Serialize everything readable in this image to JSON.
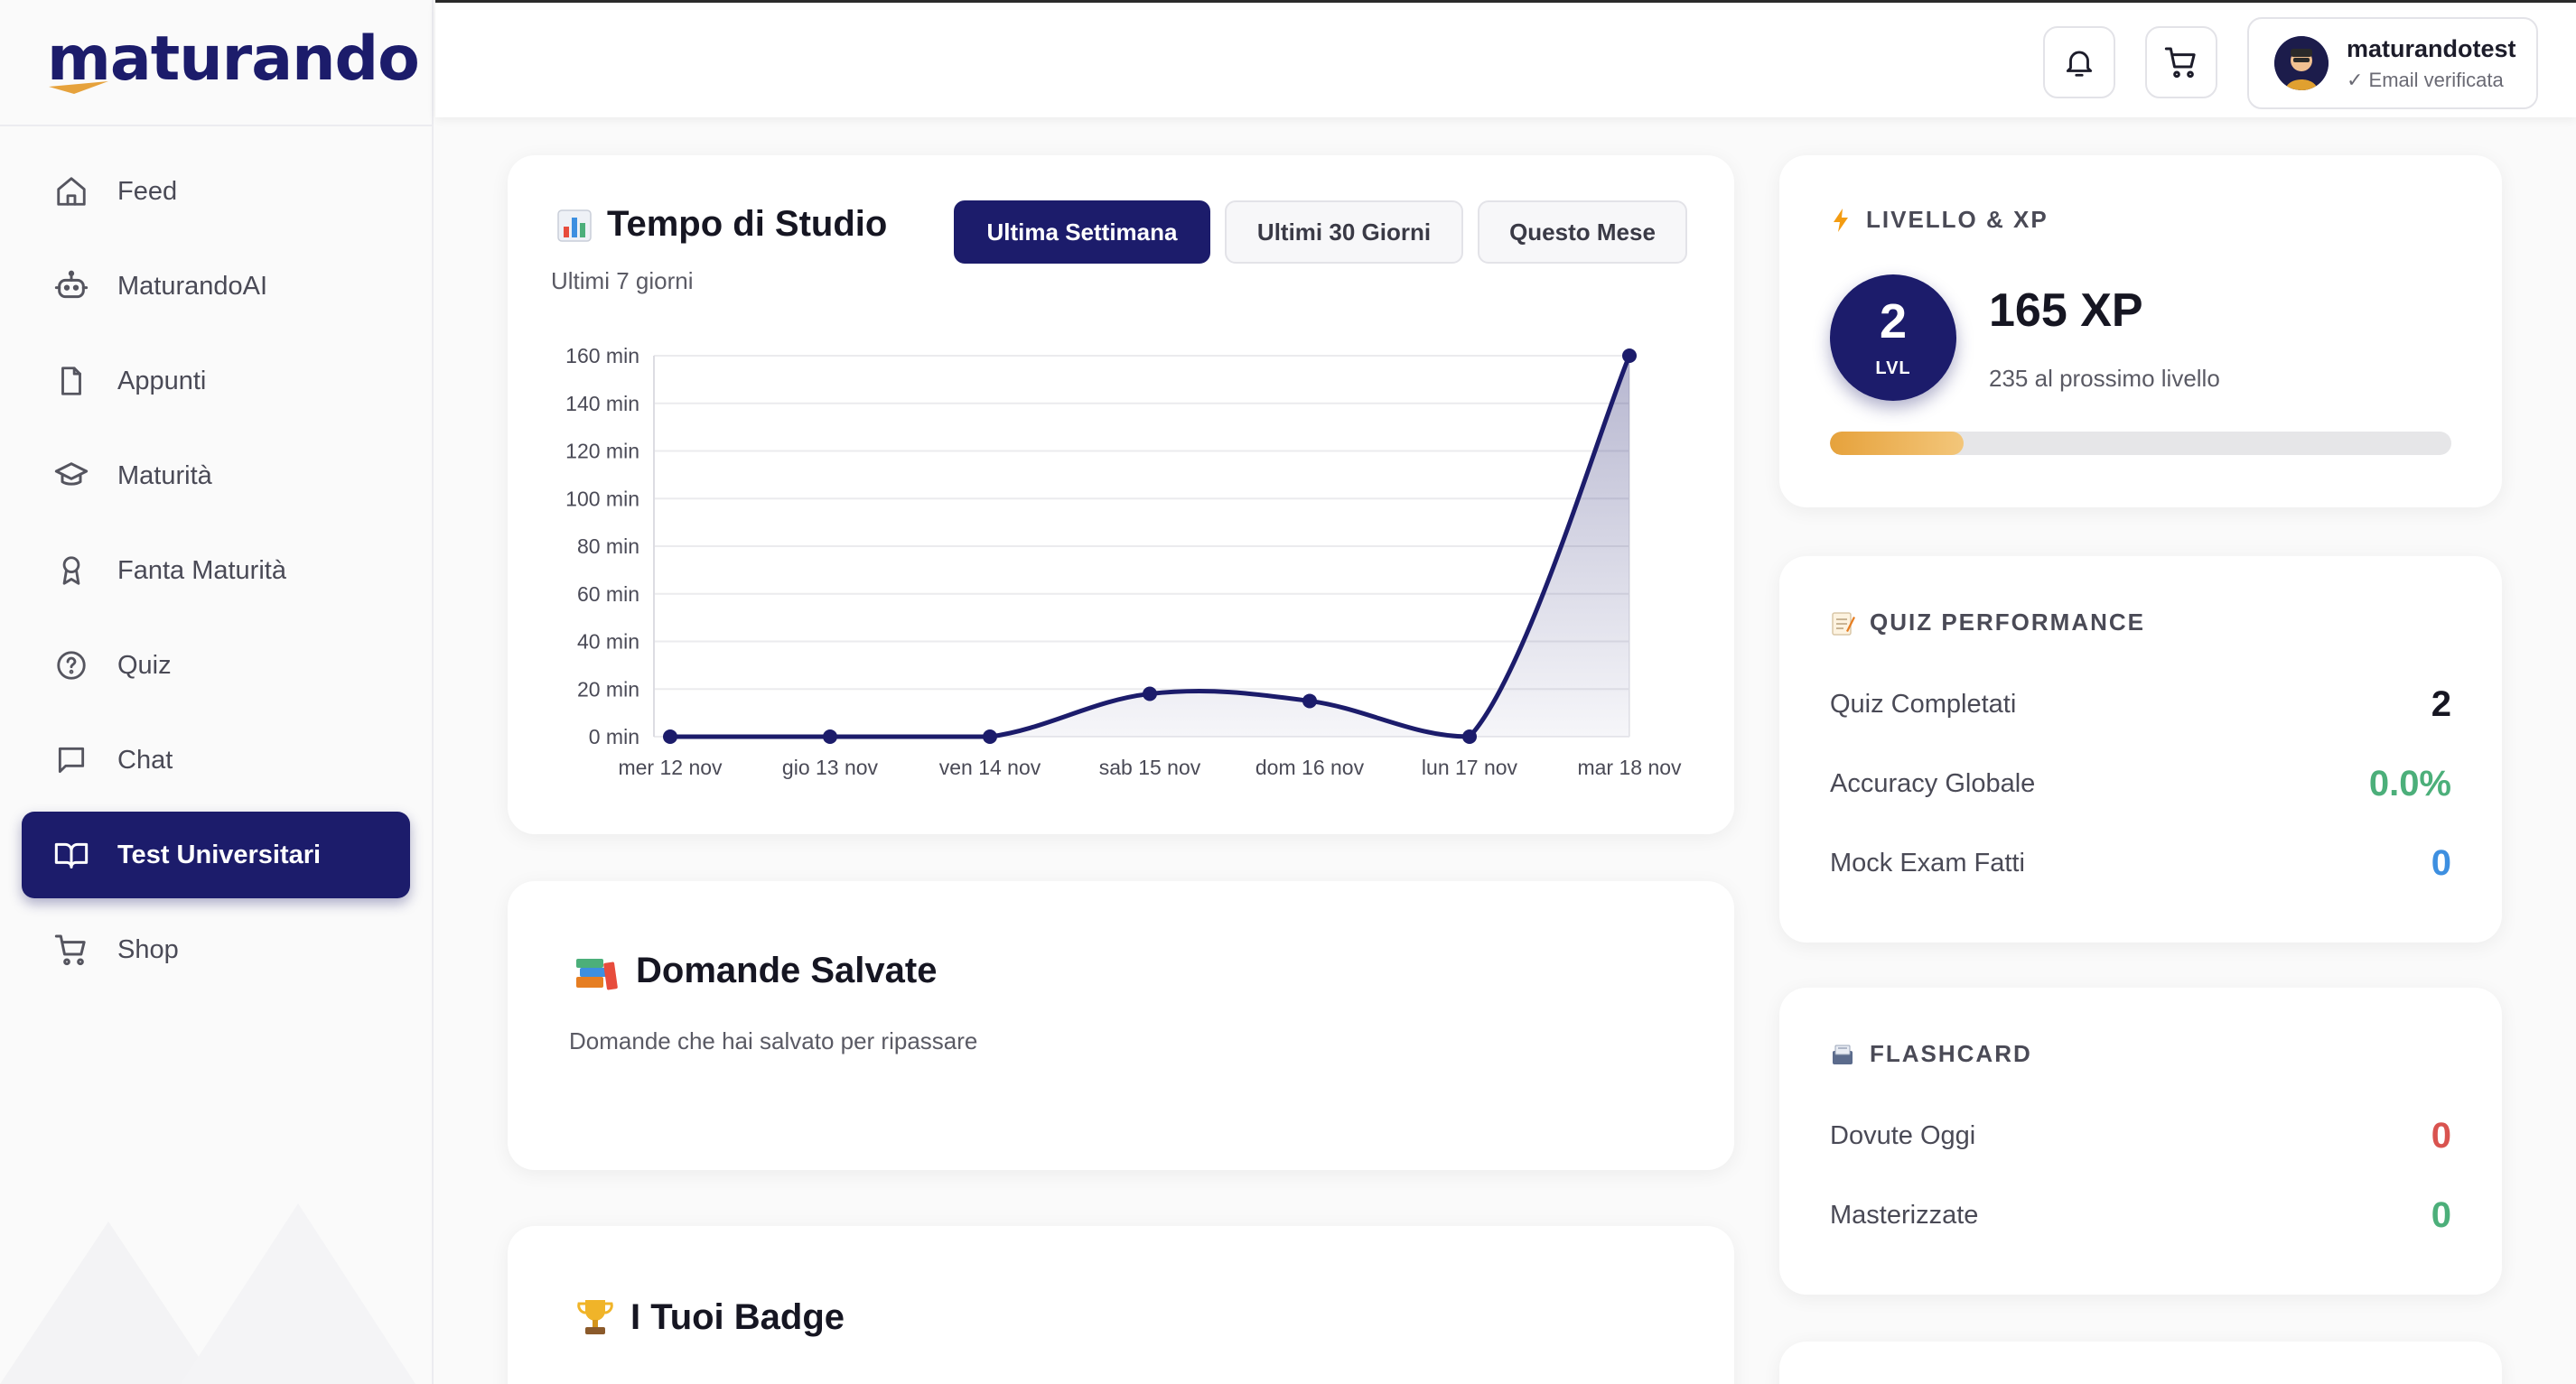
{
  "brand": {
    "logo": "maturando",
    "primary": "#1c1c6b",
    "accent": "#e6a23c"
  },
  "sidebar": {
    "items": [
      {
        "label": "Feed",
        "icon": "home-icon"
      },
      {
        "label": "MaturandoAI",
        "icon": "robot-icon"
      },
      {
        "label": "Appunti",
        "icon": "file-icon"
      },
      {
        "label": "Maturità",
        "icon": "graduation-cap-icon"
      },
      {
        "label": "Fanta Maturità",
        "icon": "award-icon"
      },
      {
        "label": "Quiz",
        "icon": "help-circle-icon"
      },
      {
        "label": "Chat",
        "icon": "chat-icon"
      },
      {
        "label": "Test Universitari",
        "icon": "book-open-icon",
        "active": true
      },
      {
        "label": "Shop",
        "icon": "cart-icon"
      }
    ]
  },
  "header": {
    "user": {
      "name": "maturandotest",
      "status": "✓ Email verificata"
    }
  },
  "study": {
    "title": "Tempo di Studio",
    "subtitle": "Ultimi 7 giorni",
    "periods": [
      {
        "label": "Ultima Settimana",
        "active": true
      },
      {
        "label": "Ultimi 30 Giorni",
        "active": false
      },
      {
        "label": "Questo Mese",
        "active": false
      }
    ]
  },
  "chart_data": {
    "type": "line",
    "categories": [
      "mer 12 nov",
      "gio 13 nov",
      "ven 14 nov",
      "sab 15 nov",
      "dom 16 nov",
      "lun 17 nov",
      "mar 18 nov"
    ],
    "values": [
      0,
      0,
      0,
      18,
      15,
      0,
      160
    ],
    "ylim": [
      0,
      160
    ],
    "yticks": [
      "0 min",
      "20 min",
      "40 min",
      "60 min",
      "80 min",
      "100 min",
      "120 min",
      "140 min",
      "160 min"
    ],
    "yunit": "min",
    "grid": true,
    "line_color": "#1c1c6b",
    "fill": "area"
  },
  "saved": {
    "title": "Domande Salvate",
    "subtitle": "Domande che hai salvato per ripassare"
  },
  "badges": {
    "title": "I Tuoi Badge"
  },
  "level": {
    "title": "LIVELLO & XP",
    "level": "2",
    "level_label": "LVL",
    "xp": "165 XP",
    "next": "235 al prossimo livello",
    "progress": 0.215
  },
  "quiz": {
    "title": "QUIZ PERFORMANCE",
    "rows": [
      {
        "label": "Quiz Completati",
        "value": "2",
        "color": "#161622"
      },
      {
        "label": "Accuracy Globale",
        "value": "0.0%",
        "color": "#4caf7a"
      },
      {
        "label": "Mock Exam Fatti",
        "value": "0",
        "color": "#3d8fe0"
      }
    ]
  },
  "flashcard": {
    "title": "FLASHCARD",
    "rows": [
      {
        "label": "Dovute Oggi",
        "value": "0",
        "color": "#d9534f"
      },
      {
        "label": "Masterizzate",
        "value": "0",
        "color": "#4caf7a"
      }
    ]
  }
}
